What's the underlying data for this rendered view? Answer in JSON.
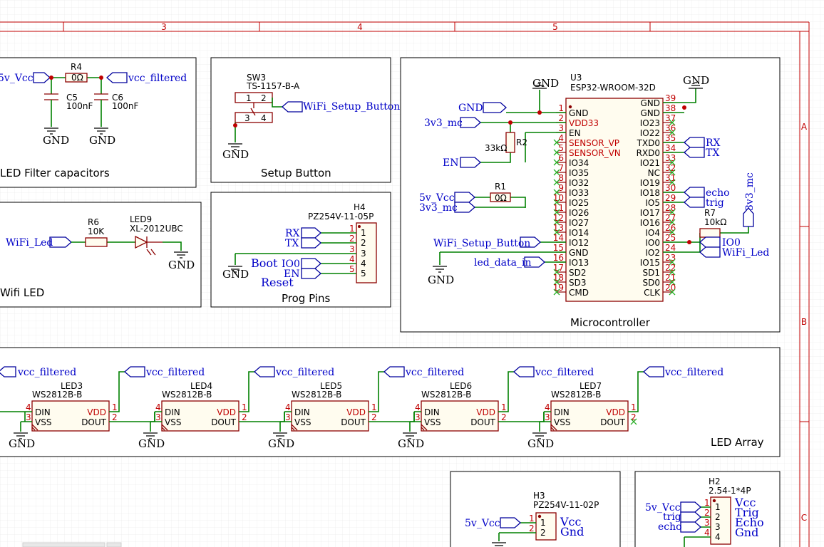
{
  "frame": {
    "columns": [
      "3",
      "4",
      "5"
    ],
    "rows": [
      "A",
      "B",
      "C"
    ]
  },
  "blocks": {
    "led_filter": "LED Filter capacitors",
    "setup": "Setup Button",
    "wifi_led": "Wifi LED",
    "prog": "Prog Pins",
    "mcu": "Microcontroller",
    "led_array": "LED Array"
  },
  "gnd": "GND",
  "filter": {
    "net_in": "5v_Vcc",
    "net_out": "vcc_filtered",
    "r_ref": "R4",
    "r_val": "0Ω",
    "c5_ref": "C5",
    "c5_val": "100nF",
    "c6_ref": "C6",
    "c6_val": "100nF"
  },
  "sw3": {
    "ref": "SW3",
    "value": "TS-1157-B-A",
    "pins": [
      "1",
      "2",
      "3",
      "4"
    ],
    "net": "WiFi_Setup_Button"
  },
  "wifi_led": {
    "net": "WiFi_Led",
    "r_ref": "R6",
    "r_val": "10K",
    "led_ref": "LED9",
    "led_val": "XL-2012UBC"
  },
  "h4": {
    "ref": "H4",
    "value": "PZ254V-11-05P",
    "nets": [
      "RX",
      "TX",
      "",
      "IO0",
      "EN"
    ],
    "pins": [
      "1",
      "2",
      "3",
      "4",
      "5"
    ],
    "boot_label": "Boot",
    "reset_label": "Reset"
  },
  "u3": {
    "ref": "U3",
    "value": "ESP32-WROOM-32D",
    "left_pins": [
      {
        "num": "1",
        "name": "GND"
      },
      {
        "num": "2",
        "name": "VDD33"
      },
      {
        "num": "3",
        "name": "EN"
      },
      {
        "num": "4",
        "name": "SENSOR_VP"
      },
      {
        "num": "5",
        "name": "SENSOR_VN"
      },
      {
        "num": "6",
        "name": "IO34"
      },
      {
        "num": "7",
        "name": "IO35"
      },
      {
        "num": "8",
        "name": "IO32"
      },
      {
        "num": "9",
        "name": "IO33"
      },
      {
        "num": "10",
        "name": "IO25"
      },
      {
        "num": "11",
        "name": "IO26"
      },
      {
        "num": "12",
        "name": "IO27"
      },
      {
        "num": "13",
        "name": "IO14"
      },
      {
        "num": "14",
        "name": "IO12"
      },
      {
        "num": "15",
        "name": "GND"
      },
      {
        "num": "16",
        "name": "IO13"
      },
      {
        "num": "17",
        "name": "SD2"
      },
      {
        "num": "18",
        "name": "SD3"
      },
      {
        "num": "19",
        "name": "CMD"
      }
    ],
    "right_pins": [
      {
        "num": "39",
        "name": "GND"
      },
      {
        "num": "38",
        "name": "GND"
      },
      {
        "num": "37",
        "name": "IO23"
      },
      {
        "num": "36",
        "name": "IO22"
      },
      {
        "num": "35",
        "name": "TXD0"
      },
      {
        "num": "34",
        "name": "RXD0"
      },
      {
        "num": "33",
        "name": "IO21"
      },
      {
        "num": "32",
        "name": "NC"
      },
      {
        "num": "31",
        "name": "IO19"
      },
      {
        "num": "30",
        "name": "IO18"
      },
      {
        "num": "29",
        "name": "IO5"
      },
      {
        "num": "28",
        "name": "IO17"
      },
      {
        "num": "27",
        "name": "IO16"
      },
      {
        "num": "26",
        "name": "IO4"
      },
      {
        "num": "25",
        "name": "IO0"
      },
      {
        "num": "24",
        "name": "IO2"
      },
      {
        "num": "23",
        "name": "IO15"
      },
      {
        "num": "22",
        "name": "SD1"
      },
      {
        "num": "21",
        "name": "SD0"
      },
      {
        "num": "20",
        "name": "CLK"
      }
    ],
    "nets": {
      "gnd": "GND",
      "v3": "3v3_mc",
      "en": "EN",
      "vcc5": "5v_Vcc",
      "v3b": "3v3_mc",
      "setup": "WiFi_Setup_Button",
      "led_data": "led_data_in",
      "rx": "RX",
      "tx": "TX",
      "echo": "echo",
      "trig": "trig",
      "io0": "IO0",
      "wifi_led": "WiFi_Led",
      "v3_right": "3v3_mc"
    },
    "r2_ref": "R2",
    "r2_val": "33kΩ",
    "r1_ref": "R1",
    "r1_val": "0Ω",
    "r7_ref": "R7",
    "r7_val": "10kΩ"
  },
  "leds": {
    "net": "vcc_filtered",
    "value": "WS2812B-B",
    "pins": {
      "din": "DIN",
      "vss": "VSS",
      "vdd": "VDD",
      "dout": "DOUT"
    },
    "pin_nums": {
      "din": "4",
      "vss": "3",
      "vdd": "1",
      "dout": "2"
    },
    "refs": [
      "LED3",
      "LED4",
      "LED5",
      "LED6",
      "LED7"
    ]
  },
  "h3": {
    "ref": "H3",
    "value": "PZ254V-11-02P",
    "net": "5v_Vcc",
    "labels": [
      "Vcc",
      "Gnd"
    ],
    "pins": [
      "1",
      "2"
    ]
  },
  "h2": {
    "ref": "H2",
    "value": "2.54-1*4P",
    "nets": [
      "5v_Vcc",
      "trig",
      "echo",
      ""
    ],
    "labels": [
      "Vcc",
      "Trig",
      "Echo",
      "Gnd"
    ],
    "pins": [
      "1",
      "2",
      "3",
      "4"
    ]
  }
}
